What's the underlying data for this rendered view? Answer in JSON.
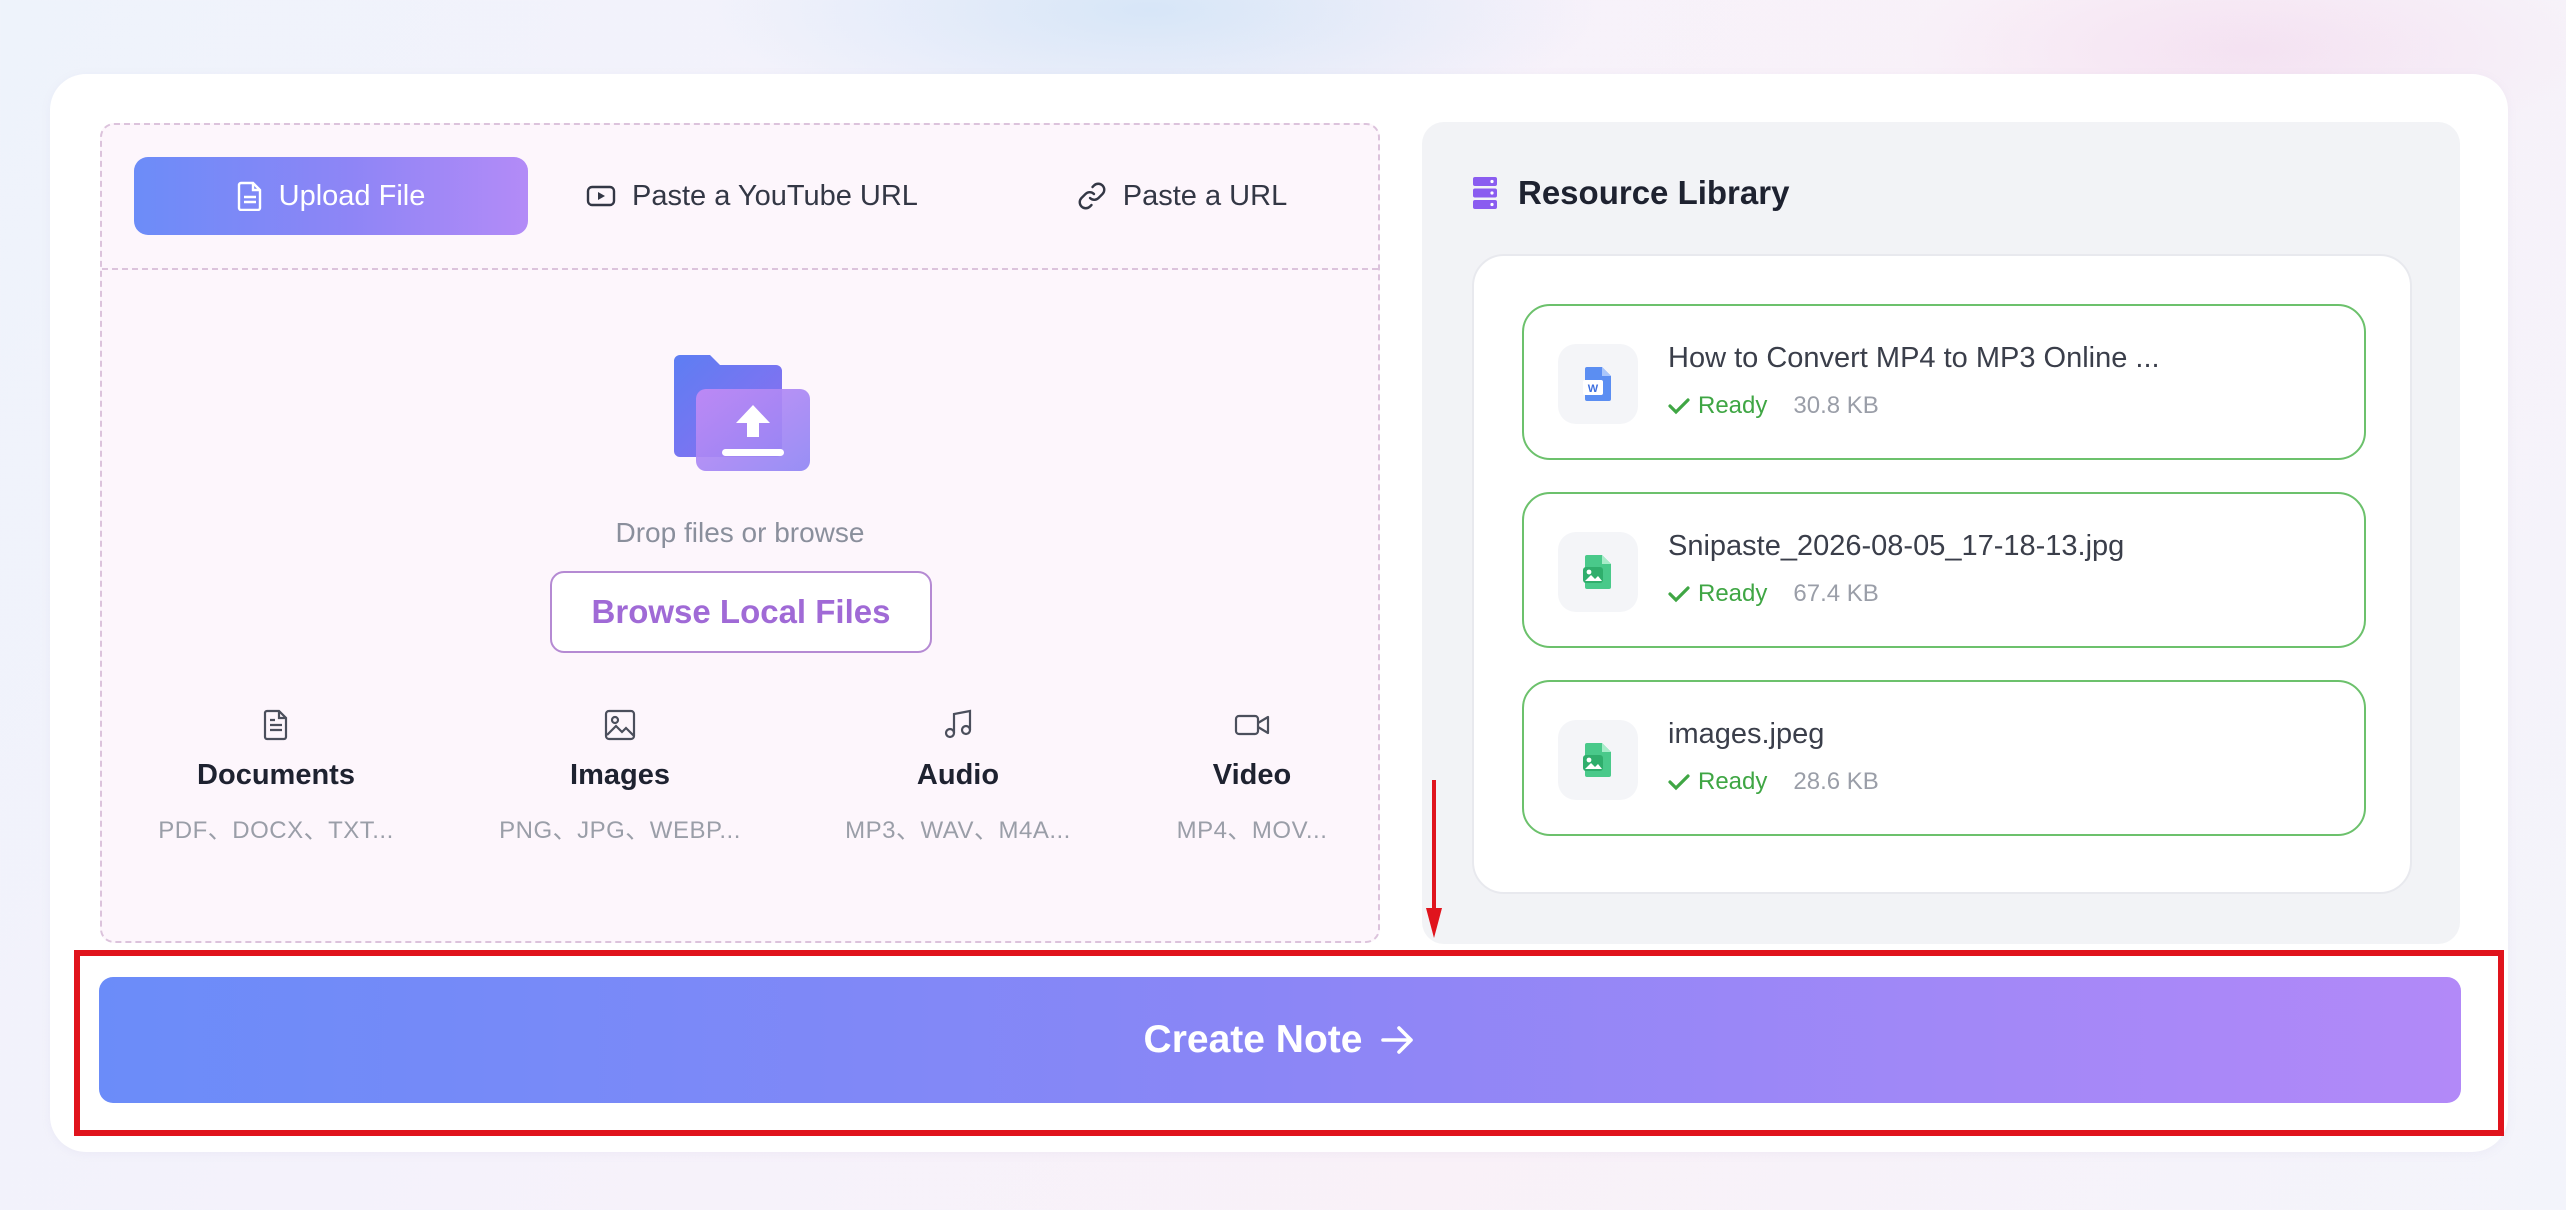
{
  "tabs": {
    "upload": "Upload File",
    "youtube": "Paste a YouTube URL",
    "url": "Paste a URL"
  },
  "upload": {
    "drop_text": "Drop files or browse",
    "browse_label": "Browse Local Files"
  },
  "file_types": [
    {
      "name": "Documents",
      "ext": "PDF、DOCX、TXT...",
      "icon": "document-icon"
    },
    {
      "name": "Images",
      "ext": "PNG、JPG、WEBP...",
      "icon": "image-icon"
    },
    {
      "name": "Audio",
      "ext": "MP3、WAV、M4A...",
      "icon": "music-note-icon"
    },
    {
      "name": "Video",
      "ext": "MP4、MOV...",
      "icon": "video-camera-icon"
    }
  ],
  "library": {
    "title": "Resource Library",
    "items": [
      {
        "name": "How to Convert MP4 to MP3 Online ...",
        "status": "Ready",
        "size": "30.8 KB",
        "icon": "word-doc-icon"
      },
      {
        "name": "Snipaste_2026-08-05_17-18-13.jpg",
        "status": "Ready",
        "size": "67.4 KB",
        "icon": "image-file-icon"
      },
      {
        "name": "images.jpeg",
        "status": "Ready",
        "size": "28.6 KB",
        "icon": "image-file-icon"
      }
    ]
  },
  "create_button": {
    "label": "Create Note"
  },
  "colors": {
    "accent_start": "#6b8cf9",
    "accent_end": "#b289f8",
    "ready_green": "#3fa644",
    "highlight_red": "#e0141d"
  }
}
